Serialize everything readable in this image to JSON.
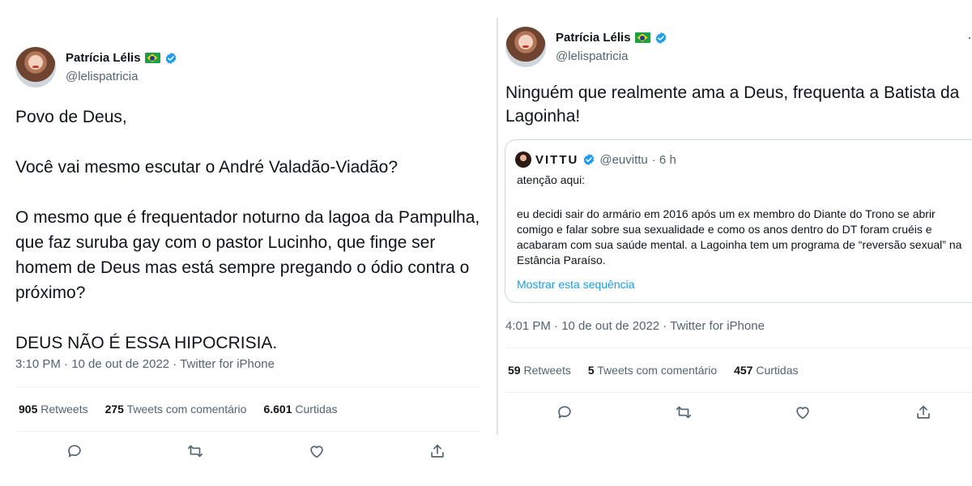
{
  "left_tweet": {
    "author": {
      "name": "Patrícia Lélis",
      "handle": "@lelispatricia"
    },
    "paragraphs": [
      "Povo de Deus,",
      "Você vai mesmo escutar o André Valadão-Viadão?",
      "O mesmo que é frequentador noturno da lagoa da Pampulha, que faz suruba gay com o pastor Lucinho, que finge ser homem de Deus mas está sempre pregando o ódio contra o próximo?",
      "DEUS NÃO É ESSA HIPOCRISIA."
    ],
    "timestamp": "3:10 PM · 10 de out de 2022 · Twitter for iPhone",
    "stats": {
      "retweets_count": "905",
      "retweets_label": "Retweets",
      "quotes_count": "275",
      "quotes_label": "Tweets com comentário",
      "likes_count": "6.601",
      "likes_label": "Curtidas"
    },
    "actions": [
      "reply-icon",
      "retweet-icon",
      "like-icon",
      "share-icon"
    ]
  },
  "right_tweet": {
    "author": {
      "name": "Patrícia Lélis",
      "handle": "@lelispatricia"
    },
    "text": "Ninguém que realmente ama a Deus, frequenta a Batista da Lagoinha!",
    "more_icon": "more-icon",
    "quoted": {
      "name": "VITTU",
      "handle": "@euvittu",
      "time": "· 6 h",
      "lead": "atenção aqui:",
      "body": "eu decidi sair do armário em 2016 após um ex membro do Diante do Trono se abrir comigo e falar sobre sua sexualidade e como os anos dentro do DT foram cruéis e acabaram com sua saúde mental. a Lagoinha tem um programa de “reversão sexual” na Estância Paraíso.",
      "link": "Mostrar esta sequência"
    },
    "timestamp": "4:01 PM · 10 de out de 2022 · Twitter for iPhone",
    "stats": {
      "retweets_count": "59",
      "retweets_label": "Retweets",
      "quotes_count": "5",
      "quotes_label": "Tweets com comentário",
      "likes_count": "457",
      "likes_label": "Curtidas"
    },
    "actions": [
      "reply-icon",
      "retweet-icon",
      "like-icon",
      "share-icon"
    ]
  },
  "colors": {
    "text": "#0f1419",
    "secondary": "#536471",
    "link": "#1d9bf0",
    "verified": "#1d9bf0",
    "divider": "#eff3f4",
    "border": "#cfd9de"
  }
}
